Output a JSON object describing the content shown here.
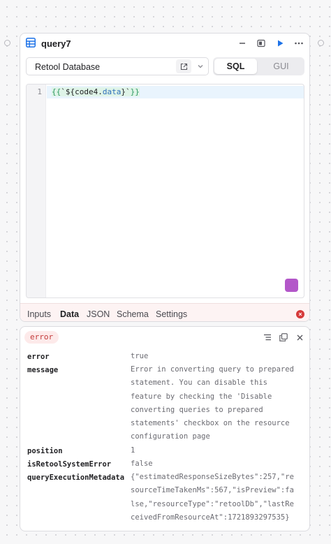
{
  "query": {
    "name": "query7",
    "resource": "Retool Database",
    "modes": [
      "SQL",
      "GUI"
    ],
    "active_mode": "SQL",
    "line_number": "1",
    "code": {
      "open_brace": "{{",
      "tick_open": "`",
      "template_open": "${",
      "object": "code4",
      "dot": ".",
      "property": "data",
      "template_close": "}",
      "tick_close": "`",
      "close_brace": "}}"
    }
  },
  "tabs": [
    "Inputs",
    "Data",
    "JSON",
    "Schema",
    "Settings"
  ],
  "active_tab": "Data",
  "result": {
    "badge": "error",
    "rows": [
      {
        "key": "error",
        "value": "true"
      },
      {
        "key": "message",
        "value": "Error in converting query to prepared\nstatement. You can disable this\nfeature by checking the 'Disable\nconverting queries to prepared\nstatements' checkbox on the resource\nconfiguration page"
      },
      {
        "key": "position",
        "value": "1"
      },
      {
        "key": "isRetoolSystemError",
        "value": "false"
      },
      {
        "key": "queryExecutionMetadata",
        "value": "{\"estimatedResponseSizeBytes\":257,\"resourceTimeTakenMs\":567,\"isPreview\":false,\"resourceType\":\"retoolDb\",\"lastReceivedFromResourceAt\":1721893297535}"
      }
    ]
  },
  "colors": {
    "accent": "#1e73e8",
    "error": "#d63a3a",
    "ai": "#b357c9"
  },
  "icons": {
    "header": [
      "table-icon",
      "minimize-icon",
      "panel-icon",
      "play-icon",
      "more-icon"
    ],
    "resource": [
      "external-link-icon",
      "chevron-down-icon"
    ],
    "result": [
      "list-icon",
      "copy-icon",
      "close-icon"
    ]
  }
}
